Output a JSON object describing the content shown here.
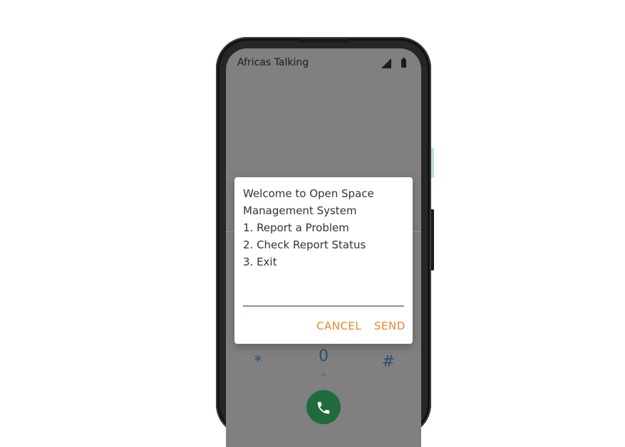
{
  "status_bar": {
    "carrier": "Africas Talking",
    "signal_icon": "cellular-signal-icon",
    "battery_icon": "battery-icon"
  },
  "dialer": {
    "keys": {
      "star": "*",
      "zero": "0",
      "zero_sub": "+",
      "hash": "#"
    },
    "call_icon": "phone-icon"
  },
  "dialog": {
    "lines": [
      "Welcome to Open Space",
      "Management System",
      "1. Report a Problem",
      "2. Check Report Status",
      "3. Exit"
    ],
    "input_value": "",
    "cancel_label": "CANCEL",
    "send_label": "SEND"
  },
  "colors": {
    "accent": "#e8862f",
    "input_underline": "#8094a8",
    "call_button": "#1f6b3e",
    "screen_dim": "#808080"
  }
}
